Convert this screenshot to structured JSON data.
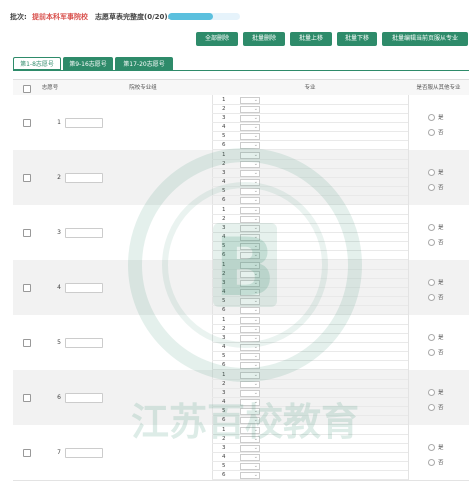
{
  "header": {
    "batch_label": "批次:",
    "batch_value": "提前本科军事院校",
    "progress_label": "志愿草表完整度(0/20):",
    "progress_fraction": 0.62
  },
  "actions": [
    {
      "label": "全部删除"
    },
    {
      "label": "批量删除"
    },
    {
      "label": "批量上移"
    },
    {
      "label": "批量下移"
    },
    {
      "label": "批量编辑当前页服从专业"
    }
  ],
  "tabs": [
    {
      "label": "第1-8志愿号",
      "active": true
    },
    {
      "label": "第9-16志愿号",
      "active": false
    },
    {
      "label": "第17-20志愿号",
      "active": false
    }
  ],
  "table": {
    "headers": {
      "select": "",
      "number": "志愿号",
      "school": "院校专业组",
      "major": "专业",
      "obey": "是否服从其他专业"
    },
    "rows": [
      {
        "number": "1"
      },
      {
        "number": "2"
      },
      {
        "number": "3"
      },
      {
        "number": "4"
      },
      {
        "number": "5"
      },
      {
        "number": "6"
      },
      {
        "number": "7"
      }
    ],
    "major_slots": [
      "1",
      "2",
      "3",
      "4",
      "5",
      "6"
    ],
    "obey_yes": "是",
    "obey_no": "否"
  },
  "watermark": {
    "text": "江苏百校教育",
    "letter": "B"
  },
  "colors": {
    "accent": "#2e8b6a",
    "batch": "#d9534f",
    "progress": "#5bc0de"
  }
}
